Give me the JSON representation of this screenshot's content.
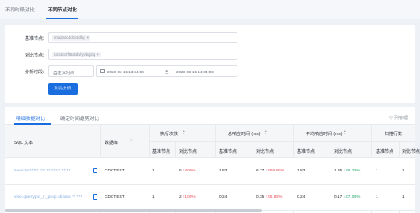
{
  "top_tabs": {
    "tab1": "不同时段对比",
    "tab2": "不同节点对比"
  },
  "filters": {
    "base_node_label": "基准节点：",
    "base_node_tag": "mfa2a0c4d3v3dhq",
    "compare_node_label": "对比节点：",
    "compare_node_tag": "cdb4cc7ft6a2dvhyvbqj2q",
    "time_label": "分析时段：",
    "time_mode": "自定义时间",
    "start_time": "2023-03-15 13:34:08",
    "time_sep": "至",
    "end_time": "2023-03-15 14:04:08",
    "analyze_button": "对比分析"
  },
  "table": {
    "sub_tab1": "明细数据对比",
    "sub_tab2": "确定时间趋势对比",
    "filter_link": "列管理",
    "headers": {
      "sql": "SQL 文本",
      "db": "数据库",
      "exec_count": "执行次数",
      "total_time": "总响应时间 (ms)",
      "avg_time": "平均响应时间 (ms)",
      "scan_rows": "扫描行数"
    },
    "sub_headers": {
      "base": "基准节点",
      "compare": "对比节点"
    },
    "rows": [
      {
        "sql": "selecte****** *** ******** *****",
        "db": "CDCTEST",
        "exec_base": "1",
        "exec_cmp": "5",
        "exec_delta": "400%",
        "total_base": "1.83",
        "total_cmp": "6.77",
        "total_delta": "269.95%",
        "avg_base": "1.83",
        "avg_cmp": "1.35",
        "avg_delta": "26.23%",
        "scan_base": "1",
        "scan_cmp": "1"
      },
      {
        "sql": "vice.query.pc_jr_prop.pbiuse ** ***",
        "db": "CDCTEST",
        "exec_base": "1",
        "exec_cmp": "2",
        "exec_delta": "100%",
        "total_base": "0.24",
        "total_cmp": "0.35",
        "total_delta": "45.83%",
        "avg_base": "0.24",
        "avg_cmp": "0.17",
        "avg_delta": "27.08%",
        "scan_base": "1",
        "scan_cmp": "1"
      }
    ]
  },
  "colors": {
    "primary": "#1a6ddf",
    "up": "#e34d59",
    "down": "#2ba471"
  }
}
